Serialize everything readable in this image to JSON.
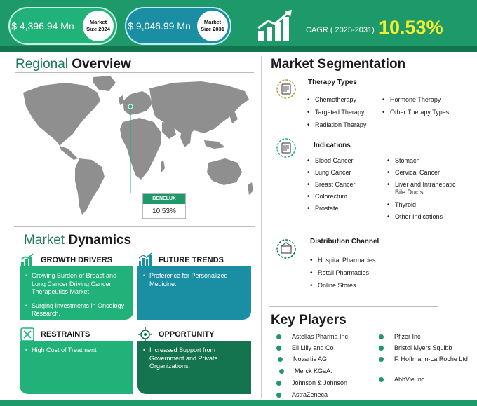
{
  "header": {
    "market_size_2024": {
      "value": "$ 4,396.94 Mn",
      "label": "Market Size 2024"
    },
    "market_size_2031": {
      "value": "$ 9,046.99 Mn",
      "label": "Market Size 2031"
    },
    "cagr_label": "CAGR ( 2025-2031)",
    "cagr_value": "10.53%"
  },
  "regional": {
    "title_normal": "Regional ",
    "title_bold": "Overview",
    "region_name": "BENELUX",
    "region_value": "10.53%"
  },
  "dynamics": {
    "title_normal": "Market ",
    "title_bold": "Dynamics",
    "growth_drivers": {
      "title": "GROWTH DRIVERS",
      "items": [
        "Growing Burden of Breast and Lung Cancer Driving Cancer Therapeutics Market.",
        "Surging Investments in Oncology Research."
      ]
    },
    "future_trends": {
      "title": "FUTURE TRENDS",
      "items": [
        "Preference for Personalized Medicine."
      ]
    },
    "restraints": {
      "title": "RESTRAINTS",
      "items": [
        "High Cost of Treatment"
      ]
    },
    "opportunity": {
      "title": "OPPORTUNITY",
      "items": [
        "Increased Support from Government and Private Organizations."
      ]
    }
  },
  "segmentation": {
    "title": "Market Segmentation",
    "therapy_types": {
      "title": "Therapy Types",
      "col1": [
        "Chemotherapy",
        "Targeted Therapy",
        "Radiation Therapy"
      ],
      "col2": [
        "Hormone Therapy",
        "Other Therapy Types"
      ]
    },
    "indications": {
      "title": "Indications",
      "col1": [
        "Blood Cancer",
        "Lung Cancer",
        "Breast Cancer",
        "Colorectum",
        "Prostate"
      ],
      "col2": [
        "Stomach",
        "Cervical Cancer",
        "Liver and Intrahepatic Bile Ducts",
        "Thyroid",
        "Other Indications"
      ]
    },
    "distribution": {
      "title": "Distribution Channel",
      "items": [
        "Hospital Pharmacies",
        "Retail Pharmacies",
        "Online Stores"
      ]
    }
  },
  "key_players": {
    "title": "Key Players",
    "col1": [
      "Astellas Pharma Inc",
      "Eli Lilly and Co",
      "Novartis AG",
      "Merck KGaA.",
      "Johnson & Johnson",
      "AstraZeneca"
    ],
    "col2": [
      "Pfizer Inc",
      "Bristol Myers Squibb",
      "F. Hoffmann-La Roche Ltd",
      "AbbVie Inc"
    ]
  },
  "colors": {
    "brand_green": "#1e9a6a",
    "dark_green": "#14744f",
    "teal": "#1a8fa3",
    "cagr_yellow": "#f5ee2a"
  }
}
